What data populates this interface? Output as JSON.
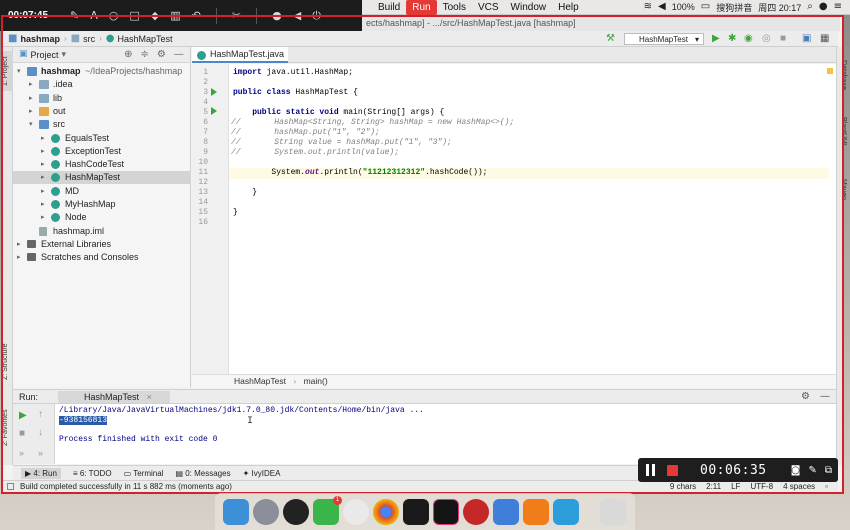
{
  "recorder_top": {
    "time": "00:07:45",
    "tools": [
      "pen-icon",
      "text-icon",
      "circle-icon",
      "rectangle-icon",
      "eraser-icon",
      "trash-icon",
      "undo-icon",
      "scissors-icon"
    ]
  },
  "menubar": {
    "items": [
      "Build",
      "Run",
      "Tools",
      "VCS",
      "Window",
      "Help"
    ],
    "active": "Run",
    "battery": "100%",
    "input_method": "搜狗拼音",
    "clock": "周四 20:17"
  },
  "window_title": "ects/hashmap] - .../src/HashMapTest.java [hashmap]",
  "navbar": {
    "crumbs": [
      "hashmap",
      "src",
      "HashMapTest"
    ],
    "run_config": "HashMapTest"
  },
  "left_strip": {
    "project_tab": "1: Project",
    "structure_tab": "Z: Structure",
    "favorites_tab": "2: Favorites"
  },
  "right_strip": {
    "tabs": [
      "Database",
      "PlantUML",
      "Maven"
    ]
  },
  "project_panel": {
    "title": "Project",
    "root": "hashmap",
    "root_path": "~/IdeaProjects/hashmap",
    "items": [
      {
        "label": "hashmap",
        "kind": "module"
      },
      {
        "label": ".idea",
        "kind": "folder"
      },
      {
        "label": "lib",
        "kind": "folder"
      },
      {
        "label": "out",
        "kind": "folder-out"
      },
      {
        "label": "src",
        "kind": "folder-src"
      },
      {
        "label": "EqualsTest",
        "kind": "class"
      },
      {
        "label": "ExceptionTest",
        "kind": "class"
      },
      {
        "label": "HashCodeTest",
        "kind": "class"
      },
      {
        "label": "HashMapTest",
        "kind": "class",
        "selected": true
      },
      {
        "label": "MD",
        "kind": "class"
      },
      {
        "label": "MyHashMap",
        "kind": "class"
      },
      {
        "label": "Node",
        "kind": "class"
      },
      {
        "label": "hashmap.iml",
        "kind": "file"
      },
      {
        "label": "External Libraries",
        "kind": "library"
      },
      {
        "label": "Scratches and Consoles",
        "kind": "scratch"
      }
    ]
  },
  "editor": {
    "tab": "HashMapTest.java",
    "line_numbers": [
      "1",
      "2",
      "3",
      "4",
      "5",
      "6",
      "7",
      "8",
      "9",
      "10",
      "11",
      "12",
      "13",
      "14",
      "15",
      "16"
    ],
    "breadcrumb_class": "HashMapTest",
    "breadcrumb_method": "main()"
  },
  "run_panel": {
    "label": "Run:",
    "tab": "HashMapTest",
    "console_path": "/Library/Java/JavaVirtualMachines/jdk1.7.0_80.jdk/Contents/Home/bin/java ...",
    "console_output": "-938156813",
    "console_finished": "Process finished with exit code 0"
  },
  "bottom_tabs": [
    "4: Run",
    "6: TODO",
    "Terminal",
    "0: Messages",
    "IvyIDEA"
  ],
  "statusbar": {
    "message": "Build completed successfully in 11 s 882 ms (moments ago)",
    "chars": "9 chars",
    "position": "2:11",
    "line_sep": "LF",
    "encoding": "UTF-8",
    "indent": "4 spaces"
  },
  "recorder_ctrl": {
    "timer": "00:06:35"
  }
}
